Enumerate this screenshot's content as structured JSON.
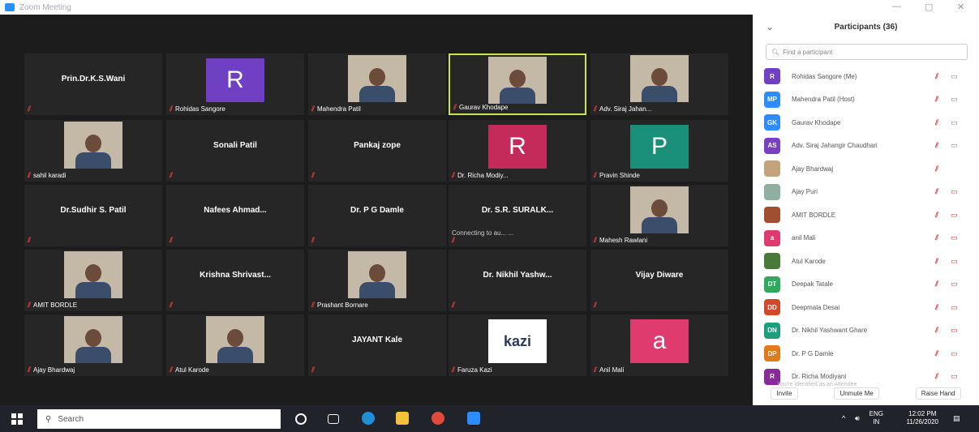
{
  "window": {
    "title": "Zoom Meeting",
    "minimize": "—",
    "maximize": "▢",
    "close": "✕"
  },
  "gallery": {
    "tiles": [
      {
        "center": "Prin.Dr.K.S.Wani",
        "label": "",
        "type": "name"
      },
      {
        "center": "",
        "label": "Rohidas Sangore",
        "type": "avatar",
        "letter": "R",
        "color": "#6f3fc4"
      },
      {
        "center": "",
        "label": "Mahendra Patil",
        "type": "photo"
      },
      {
        "center": "",
        "label": "Gaurav Khodape",
        "type": "photo",
        "active": true
      },
      {
        "center": "",
        "label": "Adv. Siraj Jahan...",
        "type": "photo"
      },
      {
        "center": "",
        "label": "sahil karadi",
        "type": "photo"
      },
      {
        "center": "Sonali Patil",
        "label": "",
        "type": "name"
      },
      {
        "center": "Pankaj zope",
        "label": "",
        "type": "name"
      },
      {
        "center": "",
        "label": "Dr. Richa Modiy...",
        "type": "avatar",
        "letter": "R",
        "color": "#c42a5a"
      },
      {
        "center": "",
        "label": "Pravin Shinde",
        "type": "avatar",
        "letter": "P",
        "color": "#1a8f7a"
      },
      {
        "center": "Dr.Sudhir S. Patil",
        "label": "",
        "type": "name"
      },
      {
        "center": "Nafees Ahmad...",
        "label": "",
        "type": "name"
      },
      {
        "center": "Dr. P G Damle",
        "label": "",
        "type": "name"
      },
      {
        "center": "Dr. S.R. SURALK...",
        "label": "",
        "type": "name",
        "status": "Connecting to au... ..."
      },
      {
        "center": "",
        "label": "Mahesh Rawlani",
        "type": "photo"
      },
      {
        "center": "",
        "label": "AMIT BORDLE",
        "type": "photo"
      },
      {
        "center": "Krishna Shrivast...",
        "label": "",
        "type": "name"
      },
      {
        "center": "",
        "label": "Prashant Bornare",
        "type": "photo"
      },
      {
        "center": "Dr. Nikhil Yashw...",
        "label": "",
        "type": "name"
      },
      {
        "center": "Vijay Diware",
        "label": "",
        "type": "name"
      },
      {
        "center": "",
        "label": "Ajay Bhardwaj",
        "type": "photo"
      },
      {
        "center": "",
        "label": "Atul Karode",
        "type": "photo"
      },
      {
        "center": "JAYANT Kale",
        "label": "",
        "type": "name"
      },
      {
        "center": "",
        "label": "Faruza Kazi",
        "type": "logo",
        "logo": "kazi"
      },
      {
        "center": "",
        "label": "Anil Mali",
        "type": "avatar",
        "letter": "a",
        "color": "#e03b6f"
      }
    ]
  },
  "participants": {
    "title": "Participants (36)",
    "search_placeholder": "Find a participant",
    "items": [
      {
        "initials": "R",
        "name": "Rohidas Sangore (Me)",
        "color": "#6f3fc4",
        "cam": "off"
      },
      {
        "initials": "MP",
        "name": "Mahendra Patil (Host)",
        "color": "#2d8cff",
        "cam": "off"
      },
      {
        "initials": "GK",
        "name": "Gaurav Khodape",
        "color": "#2d8cff",
        "cam": "off"
      },
      {
        "initials": "AS",
        "name": "Adv. Siraj Jahangir Chaudhari",
        "color": "#7b3fc4",
        "cam": "off"
      },
      {
        "initials": "",
        "name": "Ajay Bhardwaj",
        "color": "#c4a37a",
        "cam": "none"
      },
      {
        "initials": "",
        "name": "Ajay Puri",
        "color": "#8fb0a0",
        "cam": "on"
      },
      {
        "initials": "",
        "name": "AMIT BORDLE",
        "color": "#a05030",
        "cam": "on"
      },
      {
        "initials": "a",
        "name": "anil Mali",
        "color": "#e03b6f",
        "cam": "on"
      },
      {
        "initials": "",
        "name": "Atul Karode",
        "color": "#4a7a3a",
        "cam": "on"
      },
      {
        "initials": "DT",
        "name": "Deepak Tatale",
        "color": "#2eaa5a",
        "cam": "on"
      },
      {
        "initials": "DD",
        "name": "Deepmala Desai",
        "color": "#d04a2a",
        "cam": "on"
      },
      {
        "initials": "DN",
        "name": "Dr. Nikhil Yashwant Ghare",
        "color": "#1a9f7a",
        "cam": "on"
      },
      {
        "initials": "DP",
        "name": "Dr. P G Damle",
        "color": "#e07a1a",
        "cam": "on"
      },
      {
        "initials": "R",
        "name": "Dr. Richa Modiyani",
        "color": "#8a2a9a",
        "cam": "on"
      }
    ],
    "hint": "You're Identified as an Attendee",
    "buttons": {
      "invite": "Invite",
      "unmute": "Unmute Me",
      "raise": "Raise Hand"
    }
  },
  "taskbar": {
    "search": "Search",
    "lang": "ENG",
    "region": "IN",
    "time": "12:02 PM",
    "date": "11/26/2020"
  }
}
